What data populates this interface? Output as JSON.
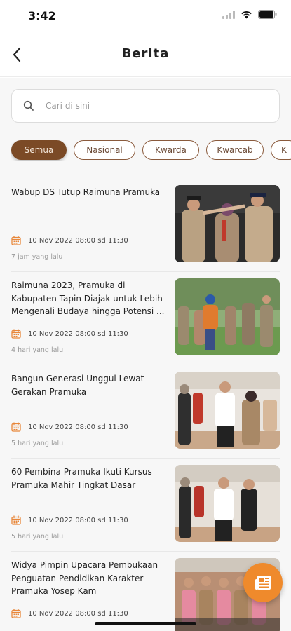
{
  "status_bar": {
    "time": "3:42"
  },
  "header": {
    "title": "Berita",
    "back_icon": "chevron-left-icon"
  },
  "search": {
    "placeholder": "Cari di sini",
    "value": "",
    "icon": "search-icon"
  },
  "categories": [
    {
      "label": "Semua",
      "active": true
    },
    {
      "label": "Nasional",
      "active": false
    },
    {
      "label": "Kwarda",
      "active": false
    },
    {
      "label": "Kwarcab",
      "active": false
    },
    {
      "label": "K",
      "active": false
    }
  ],
  "news": [
    {
      "title": "Wabup DS Tutup Raimuna Pramuka",
      "date": "10 Nov 2022 08:00 sd 11:30",
      "ago": "7 jam yang lalu"
    },
    {
      "title": "Raimuna 2023, Pramuka di Kabupaten Tapin Diajak untuk Lebih Mengenali Budaya hingga Potensi ...",
      "date": "10 Nov 2022 08:00 sd 11:30",
      "ago": "4 hari yang lalu"
    },
    {
      "title": "Bangun Generasi Unggul Lewat Gerakan Pramuka",
      "date": "10 Nov 2022 08:00 sd 11:30",
      "ago": "5 hari yang lalu"
    },
    {
      "title": "60 Pembina Pramuka Ikuti Kursus Pramuka Mahir Tingkat Dasar",
      "date": "10 Nov 2022 08:00 sd 11:30",
      "ago": "5 hari yang lalu"
    },
    {
      "title": "Widya Pimpin Upacara Pembukaan Penguatan Pendidikan Karakter Pramuka Yosep Kam",
      "date": "10 Nov 2022 08:00 sd 11:30",
      "ago": ""
    }
  ],
  "colors": {
    "accent": "#7b4a26",
    "calendar": "#e8873a",
    "fab": "#ef8a2c"
  },
  "fab": {
    "icon": "news-icon"
  }
}
